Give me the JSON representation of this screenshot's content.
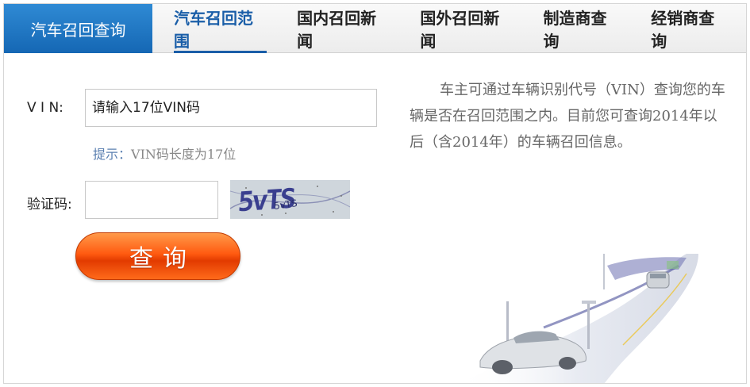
{
  "header": {
    "brand": "汽车召回查询",
    "tabs": [
      {
        "label": "汽车召回范围",
        "active": true
      },
      {
        "label": "国内召回新闻",
        "active": false
      },
      {
        "label": "国外召回新闻",
        "active": false
      },
      {
        "label": "制造商查询",
        "active": false
      },
      {
        "label": "经销商查询",
        "active": false
      }
    ]
  },
  "form": {
    "vin_label": "V I N:",
    "vin_placeholder": "请输入17位VIN码",
    "hint_prefix": "提示：",
    "hint_text": "VIN码长度为17位",
    "code_label": "验证码:",
    "captcha_text": "5vTS",
    "captcha_subtext": "5vTS",
    "query_label": "查询"
  },
  "description": "车主可通过车辆识别代号（VIN）查询您的车辆是否在召回范围之内。目前您可查询2014年以后（含2014年）的车辆召回信息。",
  "colors": {
    "brand_bg": "#1567b4",
    "active_tab": "#1a5ea8",
    "button": "#ff5a10"
  }
}
